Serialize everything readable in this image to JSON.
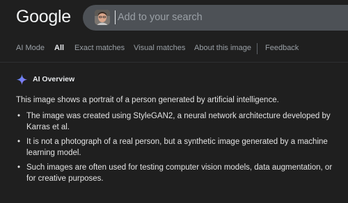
{
  "header": {
    "logo": "Google",
    "search": {
      "placeholder": "Add to your search"
    }
  },
  "tabs": [
    {
      "label": "AI Mode",
      "active": false
    },
    {
      "label": "All",
      "active": true
    },
    {
      "label": "Exact matches",
      "active": false
    },
    {
      "label": "Visual matches",
      "active": false
    },
    {
      "label": "About this image",
      "active": false
    },
    {
      "label": "Feedback",
      "active": false
    }
  ],
  "ai_overview": {
    "title": "AI Overview",
    "intro": "This image shows a portrait of a person generated by artificial intelligence.",
    "bullets": [
      "The image was created using StyleGAN2, a neural network architecture developed by Karras et al.",
      "It is not a photograph of a real person, but a synthetic image generated by a machine learning model.",
      "Such images are often used for testing computer vision models, data augmentation, or for creative purposes."
    ]
  },
  "colors": {
    "background": "#1f1f1f",
    "search_bg": "#4d5156",
    "text": "#e3e3e3",
    "muted": "#9aa0a6",
    "ai_icon_blue": "#4f8ef7"
  }
}
